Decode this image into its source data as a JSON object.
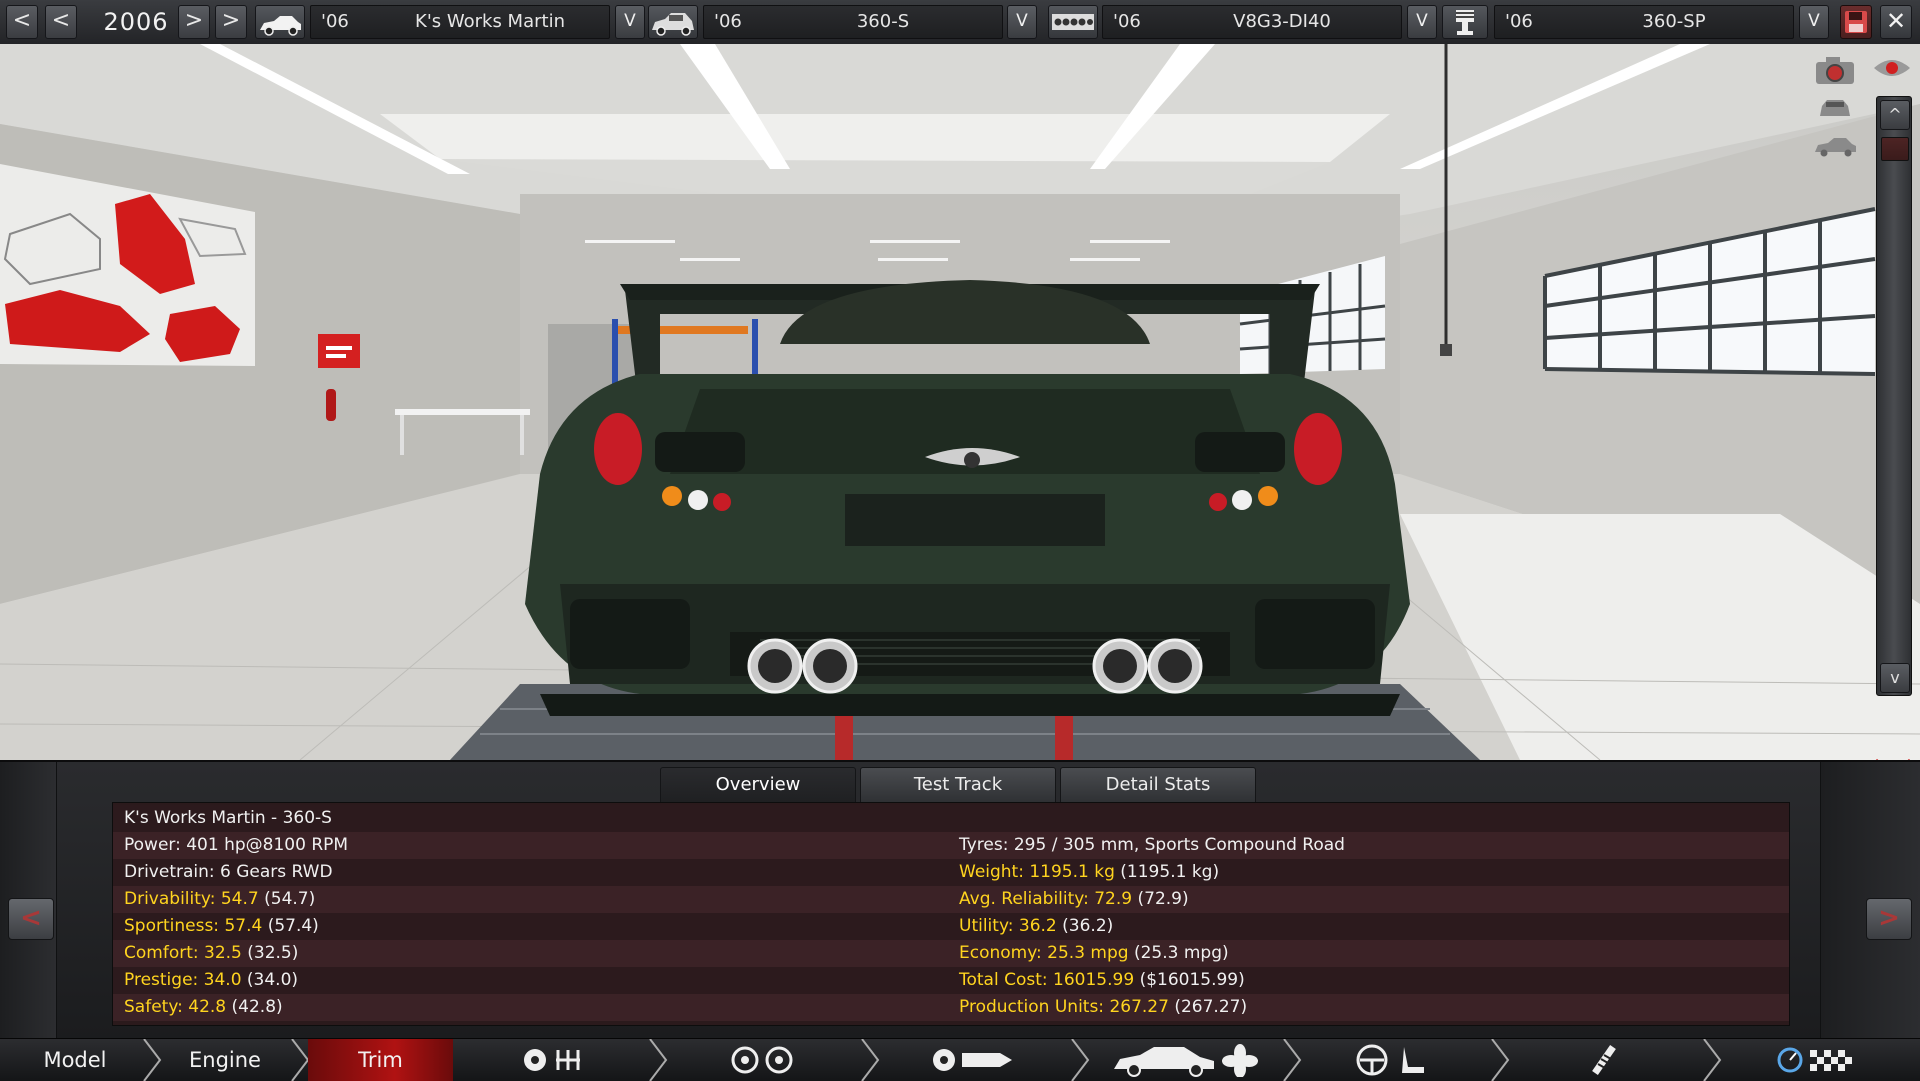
{
  "topbar": {
    "prev_decade": "<",
    "prev_year": "<",
    "year": "2006",
    "next_year": ">",
    "next_decade": ">",
    "model": {
      "year": "'06",
      "name": "K's Works Martin",
      "dropdown": "V"
    },
    "trim": {
      "year": "'06",
      "name": "360-S",
      "dropdown": "V"
    },
    "engine": {
      "year": "'06",
      "name": "V8G3-DI40",
      "dropdown": "V"
    },
    "engine_variant": {
      "year": "'06",
      "name": "360-SP",
      "dropdown": "V"
    },
    "close_label": "✕"
  },
  "viewport": {
    "scroll_up": "^",
    "scroll_down": "v",
    "icons": [
      "camera-icon",
      "car-front-icon",
      "car-side-icon",
      "eye-icon",
      "mirror-icon"
    ]
  },
  "panel": {
    "tabs": [
      {
        "label": "Overview",
        "active": true
      },
      {
        "label": "Test Track",
        "active": false
      },
      {
        "label": "Detail Stats",
        "active": false
      }
    ],
    "prev_label": "<",
    "next_label": ">",
    "title": "K's Works Martin - 360-S",
    "left_stats": [
      {
        "label": "Power: 401 hp@8100 RPM",
        "paren": "",
        "highlight": false
      },
      {
        "label": "Drivetrain: 6 Gears RWD",
        "paren": "",
        "highlight": false
      },
      {
        "label": "Drivability: 54.7",
        "paren": "(54.7)",
        "highlight": true
      },
      {
        "label": "Sportiness: 57.4",
        "paren": "(57.4)",
        "highlight": true
      },
      {
        "label": "Comfort: 32.5",
        "paren": "(32.5)",
        "highlight": true
      },
      {
        "label": "Prestige: 34.0",
        "paren": "(34.0)",
        "highlight": true
      },
      {
        "label": "Safety: 42.8",
        "paren": "(42.8)",
        "highlight": true
      }
    ],
    "right_stats": [
      {
        "label": "Tyres: 295 / 305 mm, Sports Compound Road",
        "paren": "",
        "highlight": false
      },
      {
        "label": "Weight: 1195.1 kg",
        "paren": "(1195.1 kg)",
        "highlight": true
      },
      {
        "label": "Avg. Reliability: 72.9",
        "paren": "(72.9)",
        "highlight": true
      },
      {
        "label": "Utility: 36.2",
        "paren": "(36.2)",
        "highlight": true
      },
      {
        "label": "Economy: 25.3 mpg",
        "paren": "(25.3 mpg)",
        "highlight": true
      },
      {
        "label": "Total Cost: 16015.99",
        "paren": "($16015.99)",
        "highlight": true
      },
      {
        "label": "Production Units: 267.27",
        "paren": "(267.27)",
        "highlight": true
      }
    ]
  },
  "navbar": {
    "crumbs": [
      {
        "label": "Model",
        "active": false
      },
      {
        "label": "Engine",
        "active": false
      },
      {
        "label": "Trim",
        "active": true
      }
    ],
    "icon_groups": [
      "gearbox-icon",
      "wheels-icon",
      "chassis-icon",
      "body-fan-icon",
      "interior-icon",
      "suspension-icon",
      "test-drive-icon"
    ]
  },
  "colors": {
    "highlight_text": "#ffd41f",
    "active_tab_red": "#b01212",
    "panel_bg": "#2b1a1c"
  }
}
